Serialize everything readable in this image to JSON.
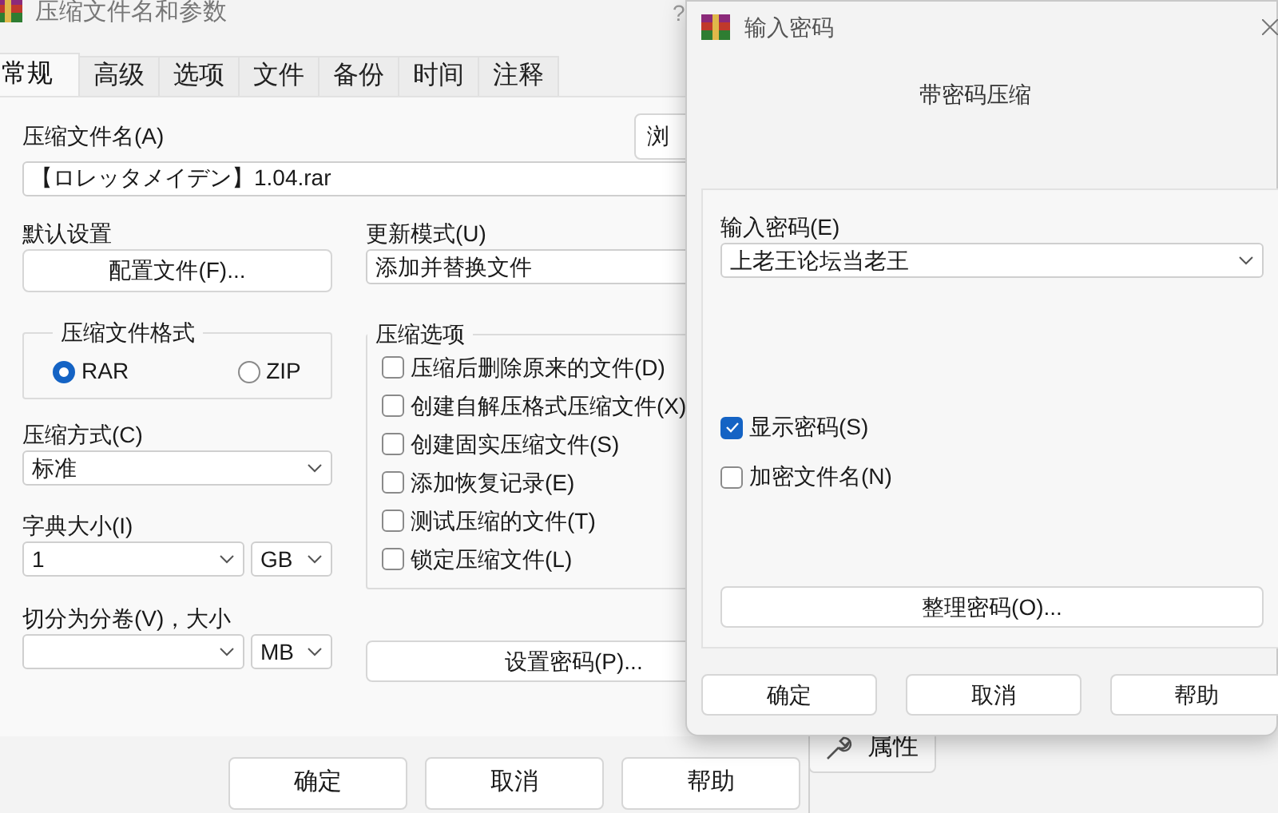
{
  "main_window": {
    "title": "压缩文件名和参数",
    "help": "?",
    "tabs": [
      {
        "label": "常规",
        "selected": true
      },
      {
        "label": "高级",
        "selected": false
      },
      {
        "label": "选项",
        "selected": false
      },
      {
        "label": "文件",
        "selected": false
      },
      {
        "label": "备份",
        "selected": false
      },
      {
        "label": "时间",
        "selected": false
      },
      {
        "label": "注释",
        "selected": false
      }
    ],
    "archive_name": {
      "label": "压缩文件名(A)",
      "value": "【ロレッタメイデン】1.04.rar"
    },
    "browse_button": "浏",
    "profiles": {
      "label": "默认设置",
      "button": "配置文件(F)..."
    },
    "update_mode": {
      "label": "更新模式(U)",
      "value": "添加并替换文件"
    },
    "archive_format": {
      "label": "压缩文件格式",
      "options": [
        {
          "label": "RAR",
          "selected": true
        },
        {
          "label": "ZIP",
          "selected": false
        }
      ]
    },
    "compression_method": {
      "label": "压缩方式(C)",
      "value": "标准"
    },
    "dictionary_size": {
      "label": "字典大小(I)",
      "value": "1",
      "unit": "GB"
    },
    "split_volumes": {
      "label": "切分为分卷(V)，大小",
      "unit": "MB"
    },
    "archiving_options": {
      "label": "压缩选项",
      "items": [
        {
          "label": "压缩后删除原来的文件(D)",
          "checked": false
        },
        {
          "label": "创建自解压格式压缩文件(X)",
          "checked": false
        },
        {
          "label": "创建固实压缩文件(S)",
          "checked": false
        },
        {
          "label": "添加恢复记录(E)",
          "checked": false
        },
        {
          "label": "测试压缩的文件(T)",
          "checked": false
        },
        {
          "label": "锁定压缩文件(L)",
          "checked": false
        }
      ]
    },
    "set_password_button": "设置密码(P)...",
    "buttons": [
      "确定",
      "取消",
      "帮助"
    ]
  },
  "password_dialog": {
    "title": "输入密码",
    "heading": "带密码压缩",
    "password": {
      "label": "输入密码(E)",
      "value": "上老王论坛当老王"
    },
    "options": [
      {
        "label": "显示密码(S)",
        "checked": true
      },
      {
        "label": "加密文件名(N)",
        "checked": false
      }
    ],
    "organize_button": "整理密码(O)...",
    "buttons": [
      "确定",
      "取消",
      "帮助"
    ]
  },
  "background_window": {
    "button": "属性"
  }
}
